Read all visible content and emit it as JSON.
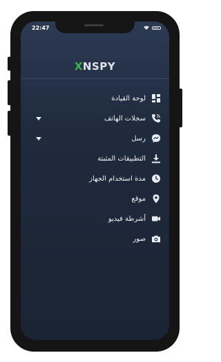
{
  "status_bar": {
    "time": "22:47"
  },
  "brand": {
    "logo_x": "X",
    "logo_rest": "NSPY",
    "accent": "#3fb64a"
  },
  "menu": {
    "items": [
      {
        "label": "لوحة القيادة",
        "icon": "dashboard-icon",
        "has_dropdown": false
      },
      {
        "label": "سجلات الهاتف",
        "icon": "phone-icon",
        "has_dropdown": true
      },
      {
        "label": "رسل",
        "icon": "messenger-icon",
        "has_dropdown": true
      },
      {
        "label": "التطبيقات المثبتة",
        "icon": "download-icon",
        "has_dropdown": false
      },
      {
        "label": "مدة استخدام الجهاز",
        "icon": "clock-icon",
        "has_dropdown": false
      },
      {
        "label": "موقع",
        "icon": "location-pin-icon",
        "has_dropdown": false
      },
      {
        "label": "أشرطة فيديو",
        "icon": "video-camera-icon",
        "has_dropdown": false
      },
      {
        "label": "صور",
        "icon": "camera-icon",
        "has_dropdown": false
      }
    ]
  }
}
